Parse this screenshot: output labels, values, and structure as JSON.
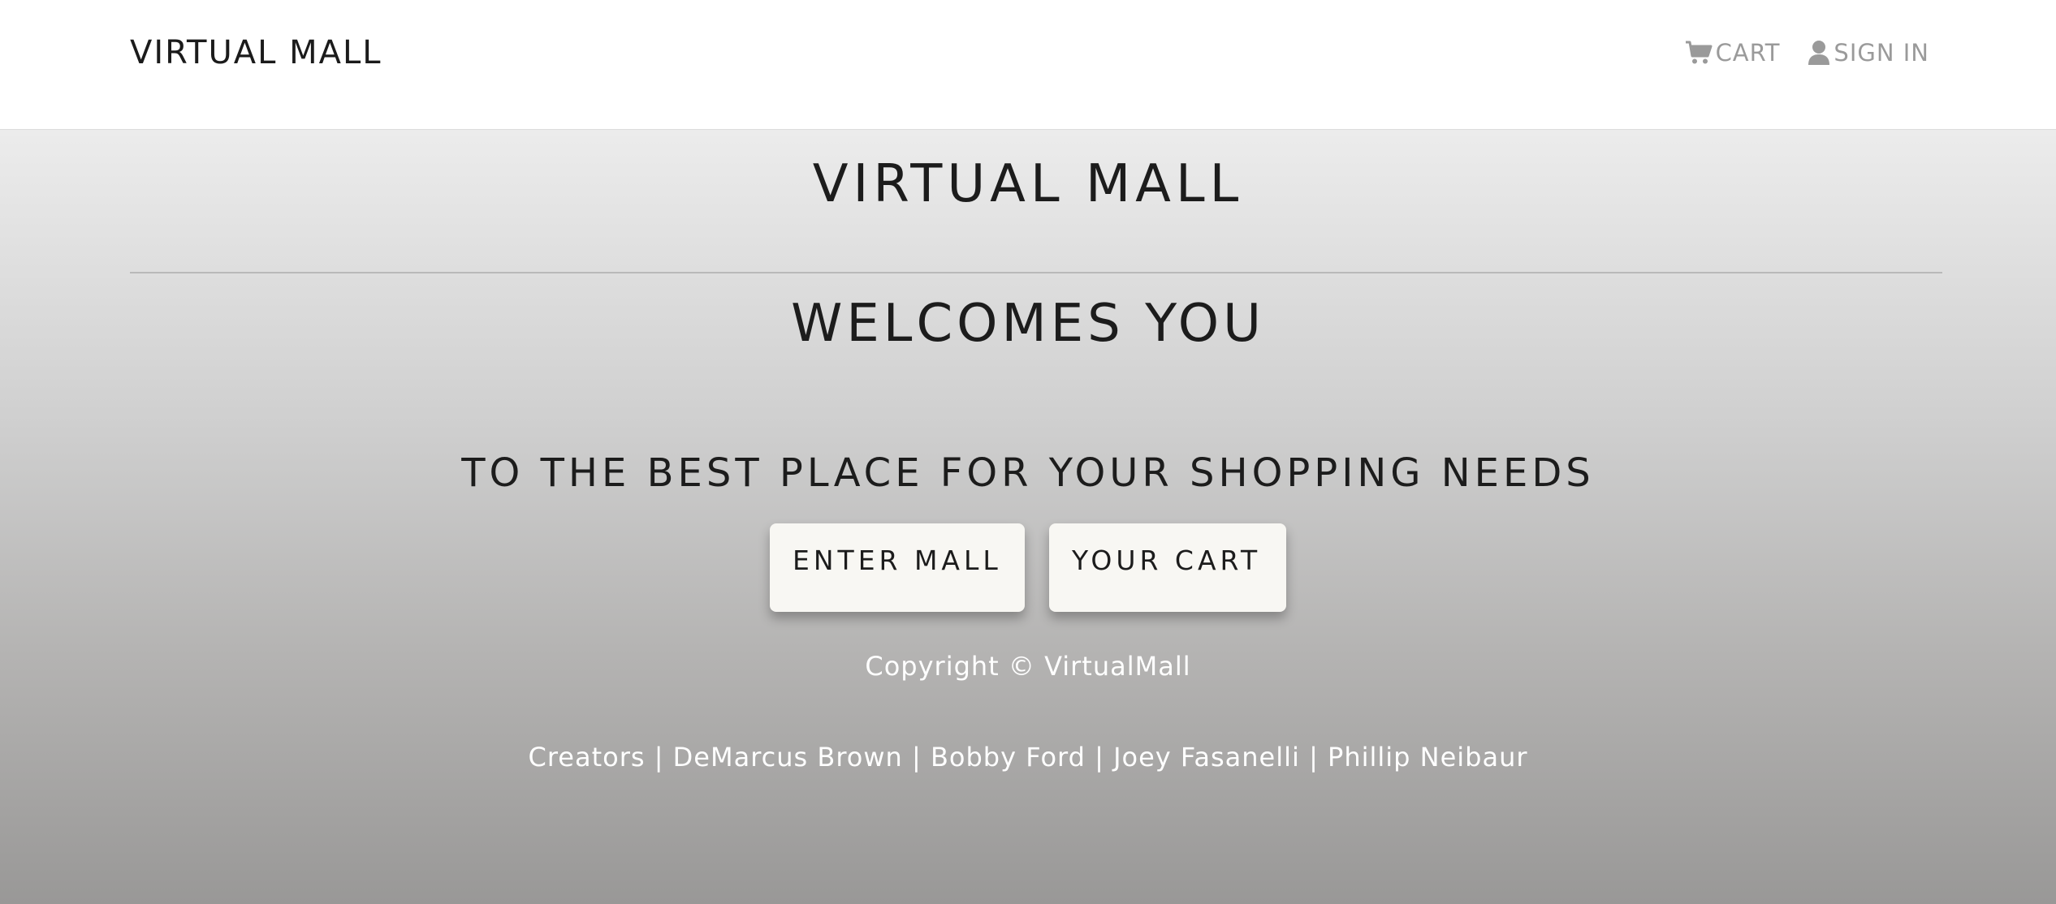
{
  "nav": {
    "brand": "VIRTUAL MALL",
    "cart_label": "CART",
    "cart_icon": "cart-icon",
    "signin_label": "SIGN IN",
    "signin_icon": "user-icon"
  },
  "hero": {
    "title": "VIRTUAL MALL",
    "subtitle": "WELCOMES YOU",
    "tagline": "TO THE BEST PLACE FOR YOUR SHOPPING NEEDS",
    "enter_button": "ENTER MALL",
    "cart_button": "YOUR CART"
  },
  "footer": {
    "copyright": "Copyright © VirtualMall",
    "creators": "Creators | DeMarcus Brown | Bobby Ford | Joey Fasanelli | Phillip Neibaur"
  },
  "colors": {
    "text_dark": "#1c1c1c",
    "nav_link": "#9a9a9a",
    "button_bg": "#f8f7f3",
    "footer_text": "#ffffff"
  }
}
